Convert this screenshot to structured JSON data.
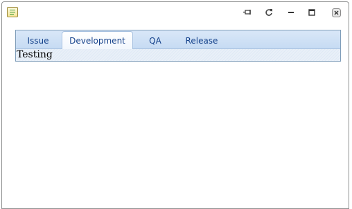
{
  "titlebar": {
    "app_icon": "notepad-icon",
    "buttons": [
      "pin-icon",
      "refresh-icon",
      "minimize-icon",
      "maximize-icon",
      "close-icon"
    ]
  },
  "tabs": [
    {
      "label": "Issue",
      "active": false
    },
    {
      "label": "Development",
      "active": true
    },
    {
      "label": "QA",
      "active": false
    },
    {
      "label": "Release",
      "active": false
    }
  ],
  "tab_panel": {
    "content": "Testing"
  },
  "colors": {
    "tab_text": "#15428b",
    "tabstrip": "#c6dbf3",
    "frame_border": "#7f9db9"
  }
}
